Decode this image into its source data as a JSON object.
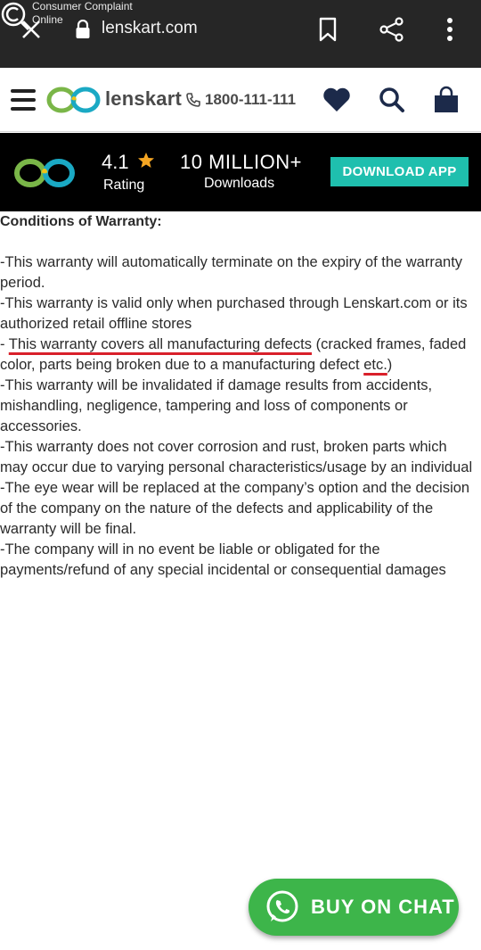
{
  "browser": {
    "watermark_line1": "Consumer Complaint",
    "watermark_line2": "Online",
    "url": "lenskart.com"
  },
  "header": {
    "brand": "lenskart",
    "phone": "1800-111-111"
  },
  "banner": {
    "rating_value": "4.1",
    "rating_label": "Rating",
    "downloads_value": "10 MILLION+",
    "downloads_label": "Downloads",
    "download_button": "DOWNLOAD APP"
  },
  "content": {
    "heading": "Conditions of Warranty:",
    "p1": "-This warranty will automatically terminate on the expiry of the warranty period.",
    "p2": "-This warranty is valid only when purchased through Lenskart.com or its authorized retail offline stores",
    "p3_prefix": "- ",
    "p3_underlined": "This warranty covers all manufacturing defects",
    "p3_middle": " (cracked frames, faded color, parts being broken due to a manufacturing defect ",
    "p3_etc": "etc.",
    "p3_suffix": ")",
    "p4": "-This warranty will be invalidated if damage results from accidents, mishandling, negligence, tampering and loss of components or accessories.",
    "p5": "-This warranty does not cover corrosion and rust, broken parts which may occur due to varying personal characteristics/usage by an individual",
    "p6": "-The eye wear will be replaced at the company’s option and the decision of the company on the nature of the defects and applicability of the warranty will be final.",
    "p7": "-The company will in no event be liable or obligated for the payments/refund of any special incidental or consequential damages"
  },
  "chat": {
    "label": "BUY ON CHAT"
  },
  "colors": {
    "accent_teal": "#1fbfae",
    "chat_green": "#3db54a",
    "underline_red": "#d9202a"
  }
}
